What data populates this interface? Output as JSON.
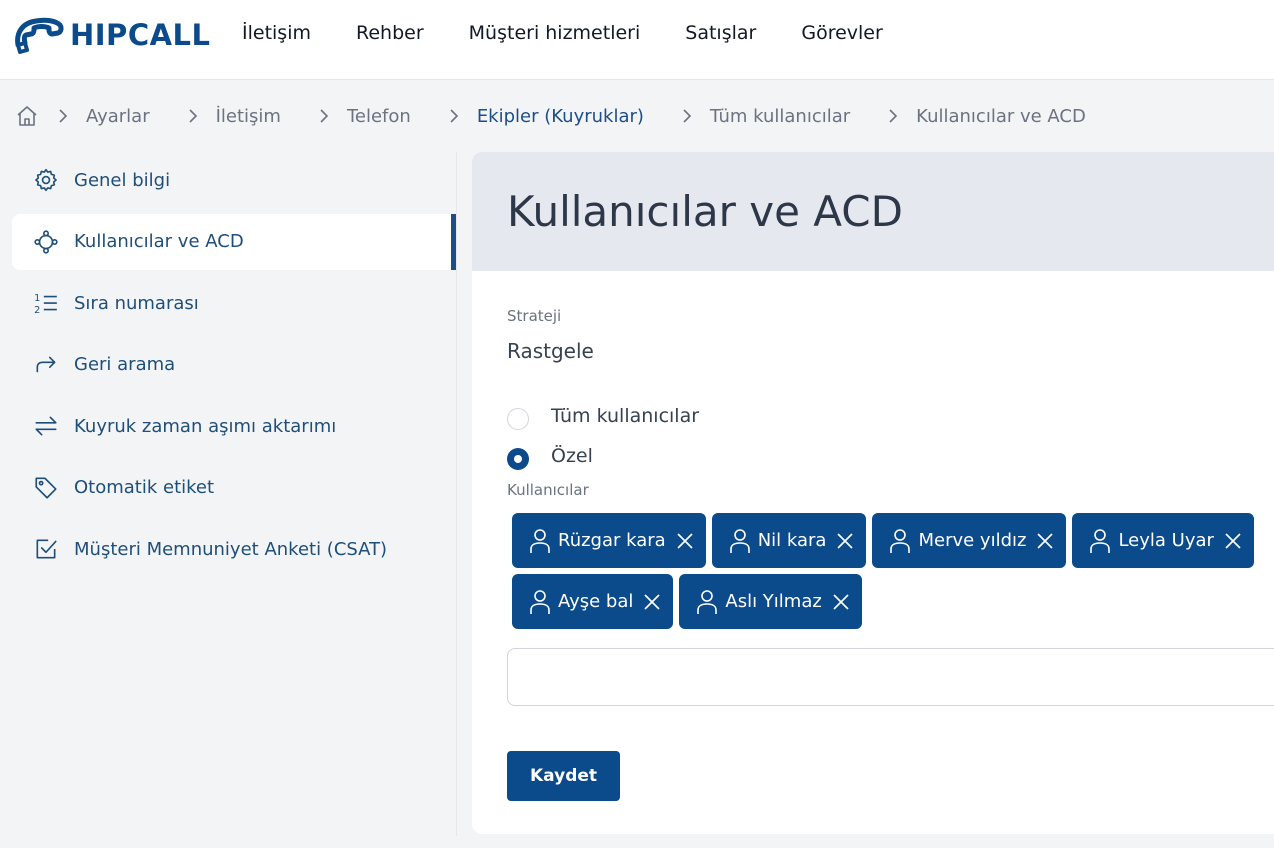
{
  "brand": {
    "name": "HIPCALL",
    "color": "#0b4a8b"
  },
  "nav": [
    {
      "label": "İletişim"
    },
    {
      "label": "Rehber"
    },
    {
      "label": "Müşteri hizmetleri"
    },
    {
      "label": "Satışlar"
    },
    {
      "label": "Görevler"
    }
  ],
  "breadcrumb": [
    {
      "label": "Ayarlar"
    },
    {
      "label": "İletişim"
    },
    {
      "label": "Telefon"
    },
    {
      "label": "Ekipler (Kuyruklar)"
    },
    {
      "label": "Tüm kullanıcılar"
    },
    {
      "label": "Kullanıcılar ve ACD"
    }
  ],
  "sidebar": {
    "items": [
      {
        "label": "Genel bilgi",
        "icon": "gear-icon"
      },
      {
        "label": "Kullanıcılar ve ACD",
        "icon": "users-network-icon",
        "active": true
      },
      {
        "label": "Sıra numarası",
        "icon": "numbered-list-icon"
      },
      {
        "label": "Geri arama",
        "icon": "forward-arrow-icon"
      },
      {
        "label": "Kuyruk zaman aşımı aktarımı",
        "icon": "transfer-arrows-icon"
      },
      {
        "label": "Otomatik etiket",
        "icon": "tag-icon"
      },
      {
        "label": "Müşteri Memnuniyet Anketi (CSAT)",
        "icon": "checkbox-icon"
      }
    ]
  },
  "main": {
    "title": "Kullanıcılar ve ACD",
    "strategy": {
      "label": "Strateji",
      "value": "Rastgele"
    },
    "radios": [
      {
        "label": "Tüm kullanıcılar",
        "checked": false
      },
      {
        "label": "Özel",
        "checked": true
      }
    ],
    "users_label": "Kullanıcılar",
    "users": [
      {
        "name": "Rüzgar kara"
      },
      {
        "name": "Nil kara"
      },
      {
        "name": "Merve yıldız"
      },
      {
        "name": "Leyla Uyar"
      },
      {
        "name": "Ayşe bal"
      },
      {
        "name": "Aslı Yılmaz"
      }
    ],
    "users_input": {
      "value": "",
      "placeholder": ""
    },
    "save_label": "Kaydet"
  }
}
